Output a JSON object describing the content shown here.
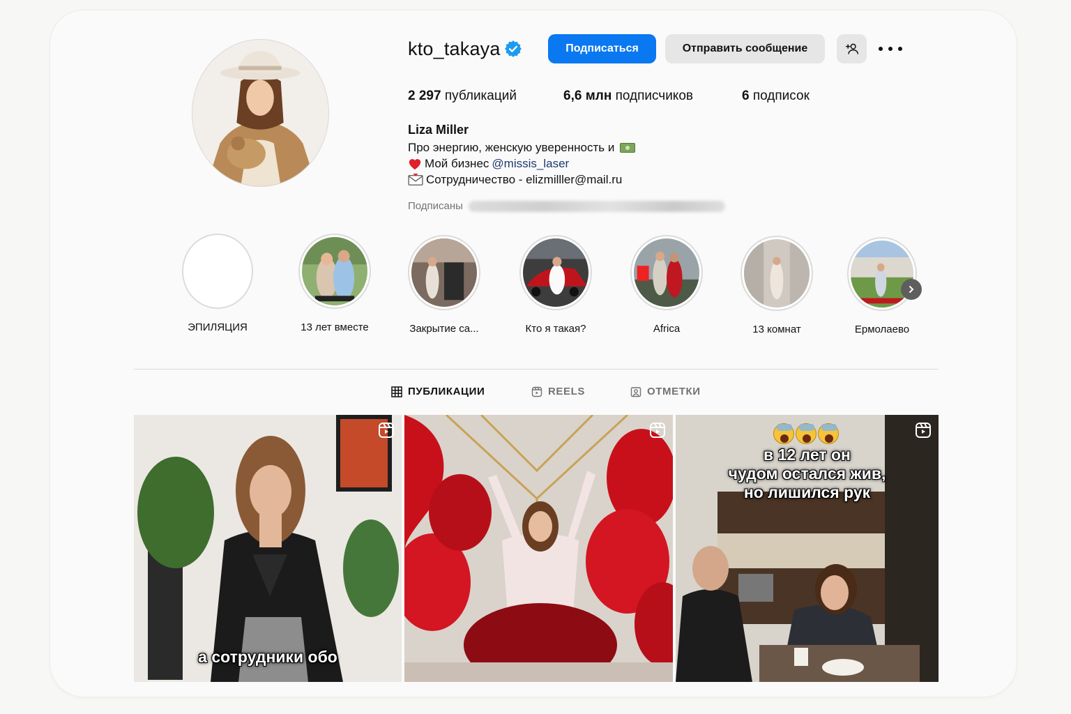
{
  "profile": {
    "username": "kto_takaya",
    "verified": true,
    "follow_label": "Подписаться",
    "message_label": "Отправить сообщение",
    "add_person_icon": "add-person-icon",
    "more_icon": "ellipsis-icon"
  },
  "stats": {
    "posts_count": "2 297",
    "posts_label": "публикаций",
    "followers_count": "6,6 млн",
    "followers_label": "подписчиков",
    "following_count": "6",
    "following_label": "подписок"
  },
  "bio": {
    "name": "Liza Miller",
    "line1": "Про энергию, женскую уверенность и",
    "line2_prefix": "Мой бизнес",
    "line2_mention": "@missis_laser",
    "line3": "Сотрудничество - elizmilller@mail.ru",
    "followed_by_label": "Подписаны"
  },
  "highlights": [
    {
      "label": "ЭПИЛЯЦИЯ"
    },
    {
      "label": "13 лет вместе"
    },
    {
      "label": "Закрытие са..."
    },
    {
      "label": "Кто я такая?"
    },
    {
      "label": "Africa"
    },
    {
      "label": "13 комнат"
    },
    {
      "label": "Ермолаево"
    }
  ],
  "tabs": [
    {
      "label": "ПУБЛИКАЦИИ",
      "icon": "grid-icon",
      "active": true
    },
    {
      "label": "REELS",
      "icon": "reels-icon",
      "active": false
    },
    {
      "label": "ОТМЕТКИ",
      "icon": "tagged-icon",
      "active": false
    }
  ],
  "posts": [
    {
      "caption": "а сотрудники обо",
      "type": "reel"
    },
    {
      "caption": "",
      "type": "reel"
    },
    {
      "caption_lines": [
        "в 12 лет он",
        "чудом остался жив,",
        "но лишился рук"
      ],
      "type": "reel"
    }
  ],
  "colors": {
    "accent": "#0a78f0",
    "verified": "#1d9bf0",
    "mention": "#1e3a6e",
    "muted": "#737373"
  }
}
